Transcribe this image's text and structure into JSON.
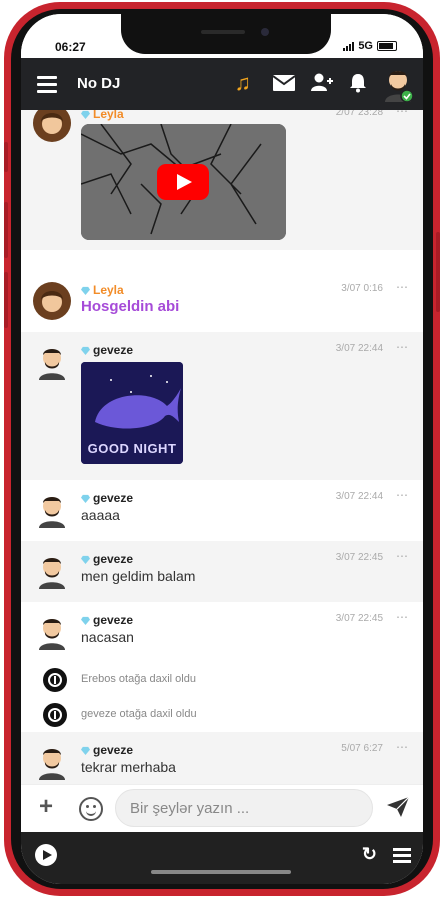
{
  "status": {
    "time": "06:27",
    "network": "5G"
  },
  "header": {
    "title": "No DJ",
    "icons": [
      "menu-icon",
      "music-note-icon",
      "envelope-icon",
      "add-friend-icon",
      "bell-icon",
      "avatar"
    ]
  },
  "colors": {
    "topbar": "#222326",
    "accent_orange": "#f28c28",
    "purple_text": "#a64bd8",
    "youtube_red": "#ff0000",
    "phone_frame": "#c8242e"
  },
  "messages": [
    {
      "user": "Leyla",
      "time": "2/07 23:28",
      "type": "video"
    },
    {
      "user": "Leyla",
      "time": "3/07 0:16",
      "text": "Hosgeldin abi"
    },
    {
      "user": "geveze",
      "time": "3/07 22:44",
      "type": "image",
      "image_caption": "GOOD NIGHT"
    },
    {
      "user": "geveze",
      "time": "3/07 22:44",
      "text": "aaaaa"
    },
    {
      "user": "geveze",
      "time": "3/07 22:45",
      "text": "men geldim balam"
    },
    {
      "user": "geveze",
      "time": "3/07 22:45",
      "text": "nacasan"
    },
    {
      "user": "geveze",
      "time": "5/07 6:27",
      "text": "tekrar merhaba"
    }
  ],
  "system_messages": [
    {
      "text": "Erebos otağa daxil oldu"
    },
    {
      "text": "geveze otağa daxil oldu"
    }
  ],
  "input": {
    "placeholder": "Bir şeylər yazın ..."
  },
  "more_label": "⋯"
}
